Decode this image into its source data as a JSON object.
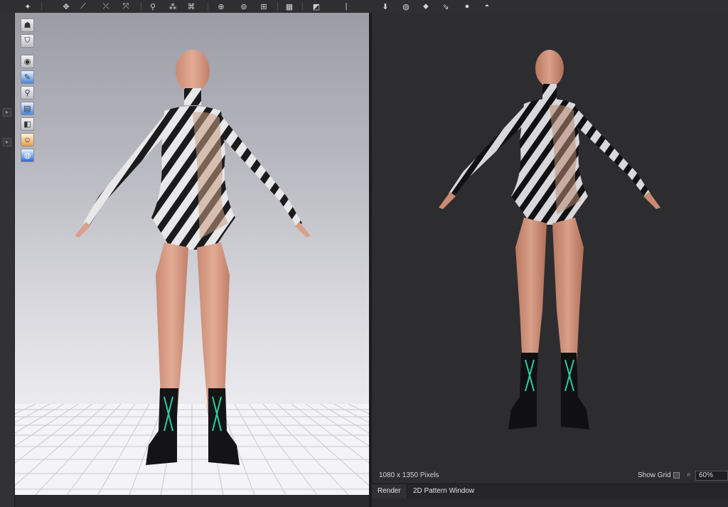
{
  "toolbar": {
    "icons": [
      "pose-icon",
      "move-icon",
      "fold-icon",
      "fold-alt-icon",
      "edit-avatar-icon",
      "pins-icon",
      "multiple-select-icon",
      "add-point-icon",
      "button-icon",
      "hole-icon",
      "texture-icon",
      "fabric-icon",
      "arrow-down-icon",
      "sphere-icon",
      "shade-icon",
      "arrange-icon",
      "light-icon",
      "dome-icon"
    ]
  },
  "viewport_tools": [
    "avatar-display-icon",
    "garment-display-icon",
    "camera-icon",
    "brush-icon",
    "light-bulb-icon",
    "color-picker-icon",
    "shading-icon",
    "skin-avatar-icon",
    "environment-globe-icon"
  ],
  "render": {
    "size_label": "1080 x 1350 Pixels",
    "show_grid_label": "Show Grid",
    "show_grid_checked": false,
    "zoom_value": "60%"
  },
  "tabs": [
    {
      "label": "Render",
      "active": true
    },
    {
      "label": "2D Pattern Window",
      "active": false
    }
  ],
  "colors": {
    "panel_bg": "#2d2d30",
    "viewport_top": "#9c9ca5",
    "viewport_bottom": "#f6f6f8",
    "skin": "#d9a08a",
    "lace": "#2ecc9a"
  }
}
